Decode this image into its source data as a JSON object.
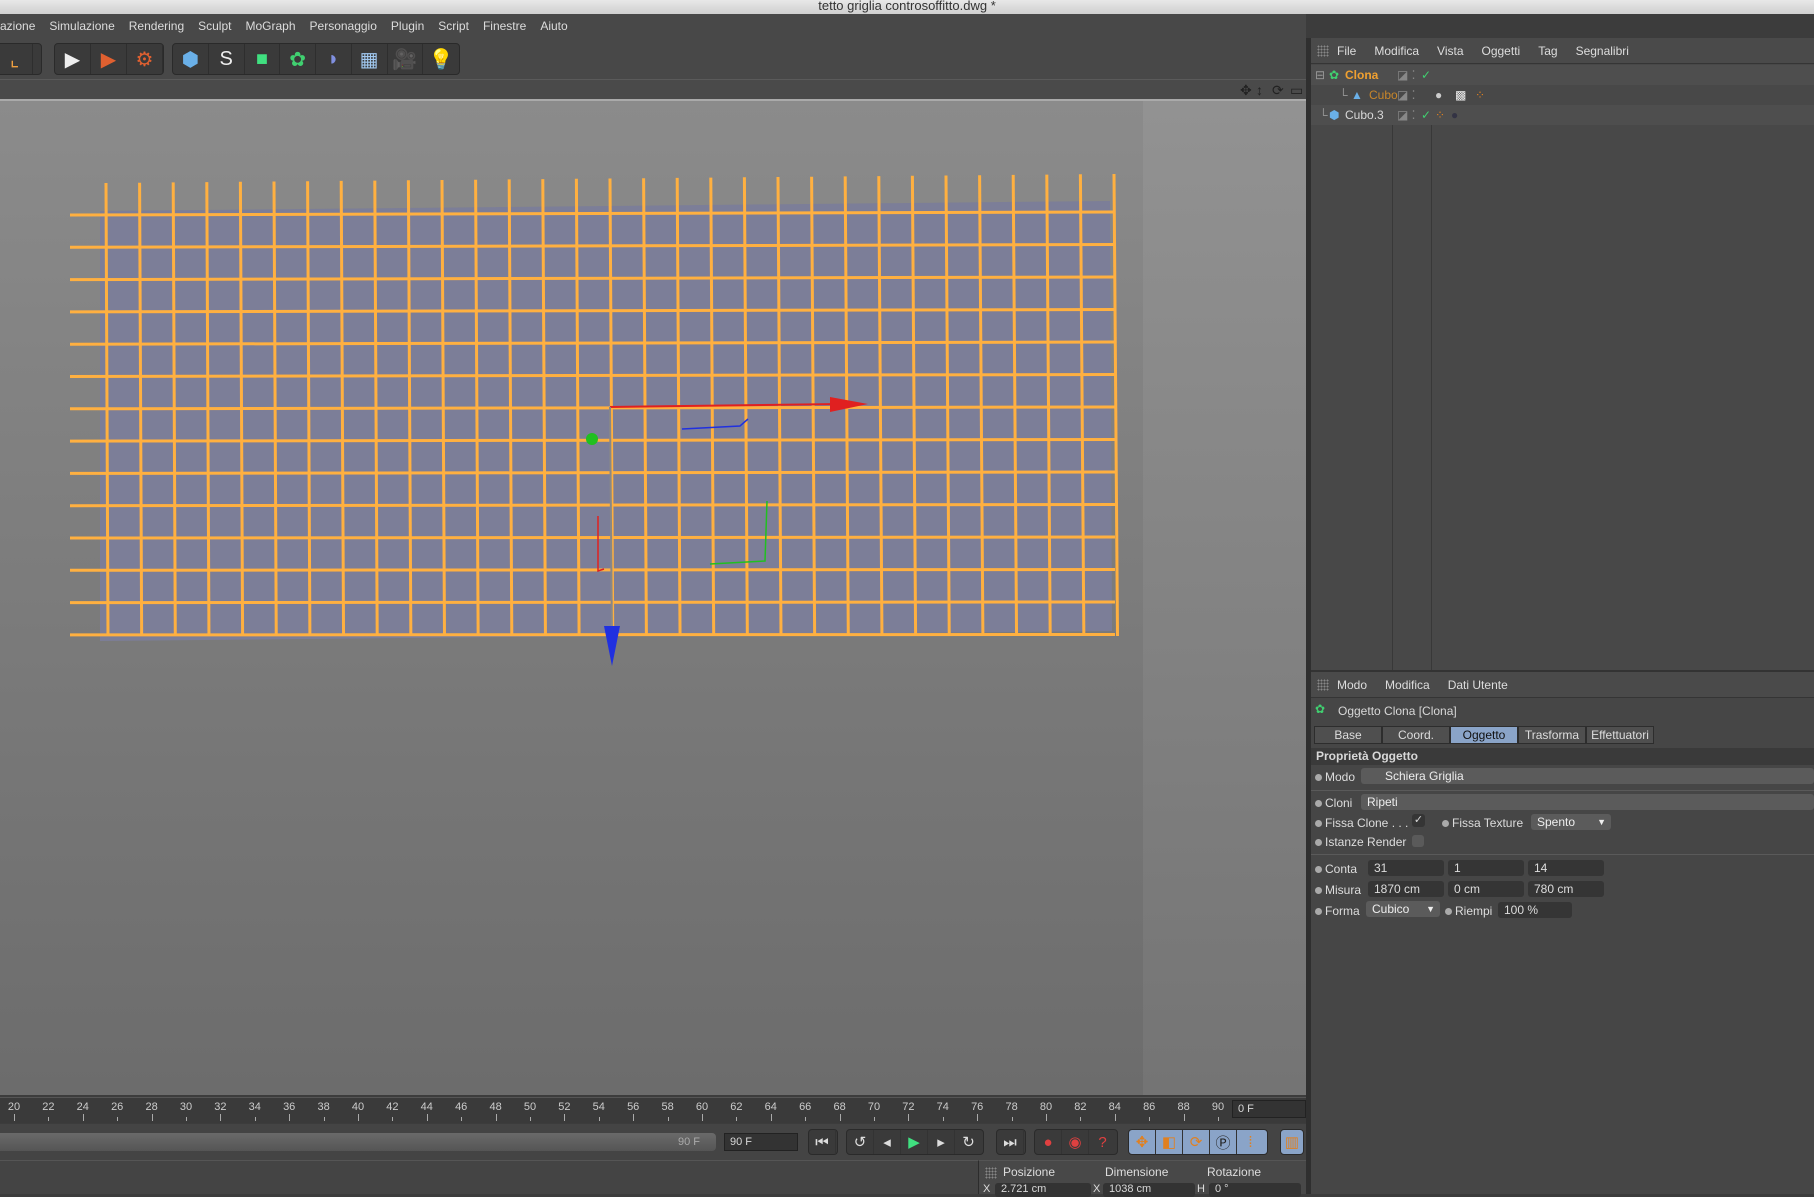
{
  "window": {
    "title": "tetto griglia controsoffitto.dwg *"
  },
  "menubar": [
    "azione",
    "Simulazione",
    "Rendering",
    "Sculpt",
    "MoGraph",
    "Personaggio",
    "Plugin",
    "Script",
    "Finestre",
    "Aiuto"
  ],
  "toolbar": {
    "icons": [
      "cube-icon",
      "spline-pen-icon",
      "subdivision-icon",
      "cloner-icon",
      "deformer-icon",
      "floor-icon",
      "camera-icon",
      "light-icon"
    ]
  },
  "timeline": {
    "ticks": [
      20,
      22,
      24,
      26,
      28,
      30,
      32,
      34,
      36,
      38,
      40,
      42,
      44,
      46,
      48,
      50,
      52,
      54,
      56,
      58,
      60,
      62,
      64,
      66,
      68,
      70,
      72,
      74,
      76,
      78,
      80,
      82,
      84,
      86,
      88,
      90
    ],
    "current_frame": "0 F",
    "slider_end": "90 F",
    "end_frame": "90 F"
  },
  "coords": {
    "headers": [
      "Posizione",
      "Dimensione",
      "Rotazione"
    ],
    "x_label": "X",
    "x_pos": "2.721 cm",
    "x_dim_label": "X",
    "x_dim": "1038 cm",
    "h_label": "H",
    "h_rot": "0 °"
  },
  "object_manager": {
    "menu": [
      "File",
      "Modifica",
      "Vista",
      "Oggetti",
      "Tag",
      "Segnalibri"
    ],
    "objects": [
      {
        "name": "Clona",
        "color": "#f0a030"
      },
      {
        "name": "Cubo",
        "color": "#c8862a"
      },
      {
        "name": "Cubo.3",
        "color": "#d8d8d8"
      }
    ]
  },
  "attributes": {
    "menu": [
      "Modo",
      "Modifica",
      "Dati Utente"
    ],
    "title": "Oggetto Clona [Clona]",
    "tabs": [
      "Base",
      "Coord.",
      "Oggetto",
      "Trasforma",
      "Effettuatori"
    ],
    "active_tab": "Oggetto",
    "section": "Proprietà Oggetto",
    "modo_label": "Modo",
    "modo_value": "Schiera Griglia",
    "cloni_label": "Cloni",
    "cloni_value": "Ripeti",
    "fissa_clone_label": "Fissa Clone . . .",
    "fissa_clone_checked": true,
    "fissa_texture_label": "Fissa Texture",
    "fissa_texture_value": "Spento",
    "istanze_label": "Istanze Render",
    "istanze_checked": false,
    "conta_label": "Conta",
    "conta": [
      "31",
      "1",
      "14"
    ],
    "misura_label": "Misura",
    "misura": [
      "1870 cm",
      "0 cm",
      "780 cm"
    ],
    "forma_label": "Forma",
    "forma_value": "Cubico",
    "riempi_label": "Riempi",
    "riempi_value": "100 %"
  },
  "colors": {
    "grid": "#ffb040",
    "axis_x": "#e02020",
    "axis_y": "#20c020",
    "axis_z": "#2030e0",
    "active_tab": "#8aa4c8"
  }
}
